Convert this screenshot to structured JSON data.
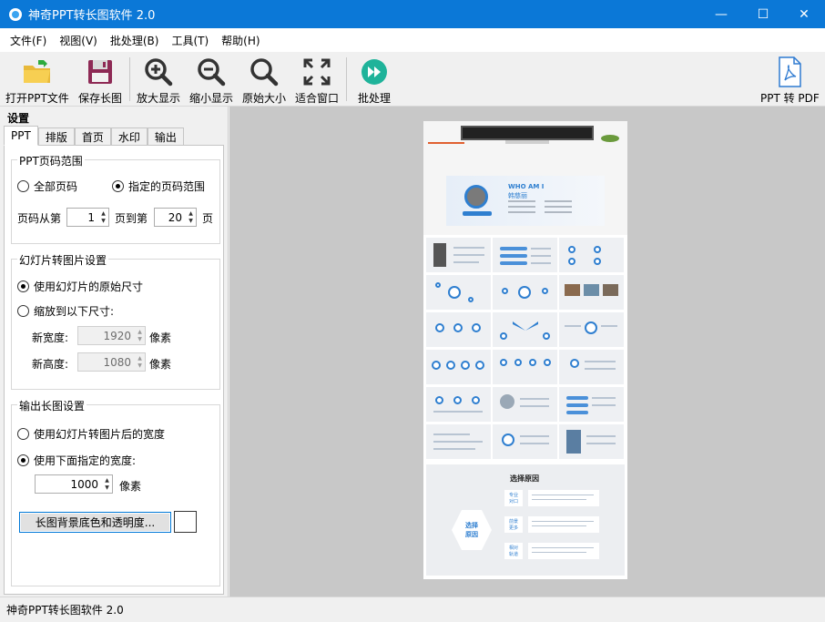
{
  "window": {
    "title": "神奇PPT转长图软件 2.0",
    "controls": {
      "minimize": "—",
      "maximize": "☐",
      "close": "✕"
    }
  },
  "menu": [
    "文件(F)",
    "视图(V)",
    "批处理(B)",
    "工具(T)",
    "帮助(H)"
  ],
  "toolbar": {
    "open": "打开PPT文件",
    "save": "保存长图",
    "zoom_in": "放大显示",
    "zoom_out": "缩小显示",
    "original": "原始大小",
    "fit": "适合窗口",
    "batch": "批处理",
    "ppt_to_pdf": "PPT 转 PDF"
  },
  "settings": {
    "header": "设置",
    "tabs": [
      "PPT",
      "排版",
      "首页",
      "水印",
      "输出"
    ],
    "page_range": {
      "title": "PPT页码范围",
      "all_pages": "全部页码",
      "specified_range": "指定的页码范围",
      "from_label": "页码从第",
      "from_value": "1",
      "to_label": "页到第",
      "to_value": "20",
      "suffix": "页"
    },
    "slide_image": {
      "title": "幻灯片转图片设置",
      "use_original": "使用幻灯片的原始尺寸",
      "scale_to": "缩放到以下尺寸:",
      "width_label": "新宽度:",
      "width_value": "1920",
      "height_label": "新高度:",
      "height_value": "1080",
      "unit": "像素"
    },
    "output": {
      "title": "输出长图设置",
      "use_converted_width": "使用幻灯片转图片后的宽度",
      "use_specified_width": "使用下面指定的宽度:",
      "width_value": "1000",
      "unit": "像素",
      "bg_button": "长图背景底色和透明度..."
    }
  },
  "preview": {
    "slide1": {
      "who": "WHO AM I",
      "name": "韩慈丽"
    },
    "slide_last": {
      "title": "选择原因",
      "center": "选择\n原因",
      "items": [
        "专业\n对口",
        "前景\n更多",
        "相对\n轨道"
      ]
    }
  },
  "statusbar": {
    "text": "神奇PPT转长图软件 2.0"
  },
  "colors": {
    "titlebar": "#0b78d7",
    "accent": "#2f7fd0",
    "preview_bg": "#c8c8c8"
  }
}
